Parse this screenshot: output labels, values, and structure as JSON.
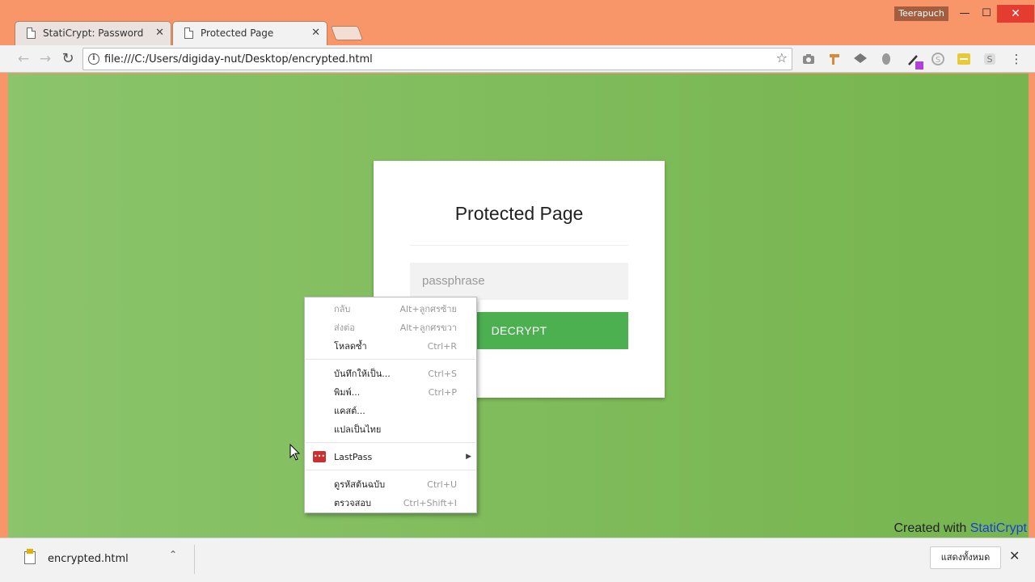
{
  "window": {
    "profile_name": "Teerapuch",
    "controls": {
      "minimize": "—",
      "maximize": "☐",
      "close": "✕"
    }
  },
  "tabs": [
    {
      "title": "StatiCrypt: Password prot",
      "close": "✕",
      "active": false
    },
    {
      "title": "Protected Page",
      "close": "✕",
      "active": true
    }
  ],
  "toolbar": {
    "back": "←",
    "forward": "→",
    "reload": "↻",
    "url": "file:///C:/Users/digiday-nut/Desktop/encrypted.html",
    "info_glyph": "i",
    "star": "☆",
    "extensions": [
      "camera-icon",
      "brush-icon",
      "layers-icon",
      "ear-icon",
      "eyedropper-icon",
      "skype-icon",
      "lastpass-icon",
      "s-icon"
    ],
    "menu": "⋮"
  },
  "page": {
    "heading": "Protected Page",
    "passphrase_placeholder": "passphrase",
    "decrypt_label": "DECRYPT",
    "credit_prefix": "Created with ",
    "credit_link": "StatiCrypt",
    "colors": {
      "background": "#7fbb5a",
      "button": "#4caf50",
      "link": "#1a3fd1"
    }
  },
  "context_menu": {
    "items": [
      {
        "label": "กลับ",
        "shortcut": "Alt+ลูกศรซ้าย",
        "disabled": true
      },
      {
        "label": "ส่งต่อ",
        "shortcut": "Alt+ลูกศรขวา",
        "disabled": true
      },
      {
        "label": "โหลดซ้ำ",
        "shortcut": "Ctrl+R",
        "disabled": false
      },
      {
        "label": "บันทึกให้เป็น...",
        "shortcut": "Ctrl+S",
        "disabled": false
      },
      {
        "label": "พิมพ์...",
        "shortcut": "Ctrl+P",
        "disabled": false
      },
      {
        "label": "แคสต์...",
        "shortcut": "",
        "disabled": false
      },
      {
        "label": "แปลเป็นไทย",
        "shortcut": "",
        "disabled": false
      },
      {
        "label": "LastPass",
        "shortcut": "",
        "icon": "lastpass-icon",
        "icon_text": "•••",
        "submenu": "▶"
      },
      {
        "label": "ดูรหัสต้นฉบับ",
        "shortcut": "Ctrl+U",
        "disabled": false
      },
      {
        "label": "ตรวจสอบ",
        "shortcut": "Ctrl+Shift+I",
        "disabled": false
      }
    ]
  },
  "download_bar": {
    "file_name": "encrypted.html",
    "chevron": "⌃",
    "show_all": "แสดงทั้งหมด",
    "close": "✕"
  }
}
